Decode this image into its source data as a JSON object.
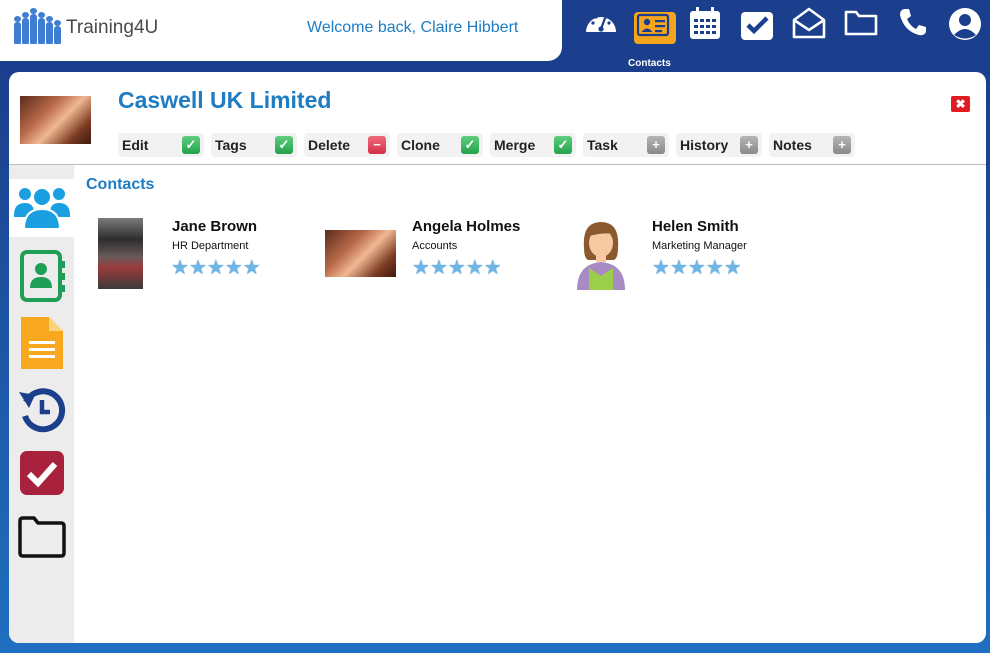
{
  "header": {
    "logo_text": "Training4U",
    "welcome": "Welcome back, Claire Hibbert"
  },
  "topnav": {
    "items": [
      {
        "name": "dashboard",
        "icon": "speedometer-icon"
      },
      {
        "name": "contacts",
        "icon": "contact-card-icon",
        "active": true
      },
      {
        "name": "calendar",
        "icon": "calendar-icon"
      },
      {
        "name": "tasks",
        "icon": "checkbox-icon"
      },
      {
        "name": "email",
        "icon": "envelope-icon"
      },
      {
        "name": "files",
        "icon": "folder-icon"
      },
      {
        "name": "phone",
        "icon": "phone-icon"
      },
      {
        "name": "account",
        "icon": "user-icon"
      }
    ],
    "active_label": "Contacts"
  },
  "company": {
    "name": "Caswell UK Limited"
  },
  "toolbar": [
    {
      "label": "Edit",
      "state": "check"
    },
    {
      "label": "Tags",
      "state": "check"
    },
    {
      "label": "Delete",
      "state": "minus"
    },
    {
      "label": "Clone",
      "state": "check"
    },
    {
      "label": "Merge",
      "state": "check"
    },
    {
      "label": "Task",
      "state": "plus"
    },
    {
      "label": "History",
      "state": "plus"
    },
    {
      "label": "Notes",
      "state": "plus"
    }
  ],
  "sidebar": {
    "items": [
      "people-icon",
      "address-book-icon",
      "document-icon",
      "history-icon",
      "checkbox-icon",
      "folder-icon"
    ],
    "active": "people-icon"
  },
  "contacts_section": {
    "title": "Contacts",
    "contacts": [
      {
        "name": "Jane Brown",
        "role": "HR Department",
        "stars": 5
      },
      {
        "name": "Angela Holmes",
        "role": "Accounts",
        "stars": 5
      },
      {
        "name": "Helen Smith",
        "role": "Marketing Manager",
        "stars": 5
      }
    ]
  },
  "colors": {
    "brand_blue": "#1d7cc2",
    "nav_bg": "#1b3f8c",
    "active_orange": "#f5a51c",
    "close_red": "#e11b22",
    "star_blue": "#6fb6e6"
  }
}
